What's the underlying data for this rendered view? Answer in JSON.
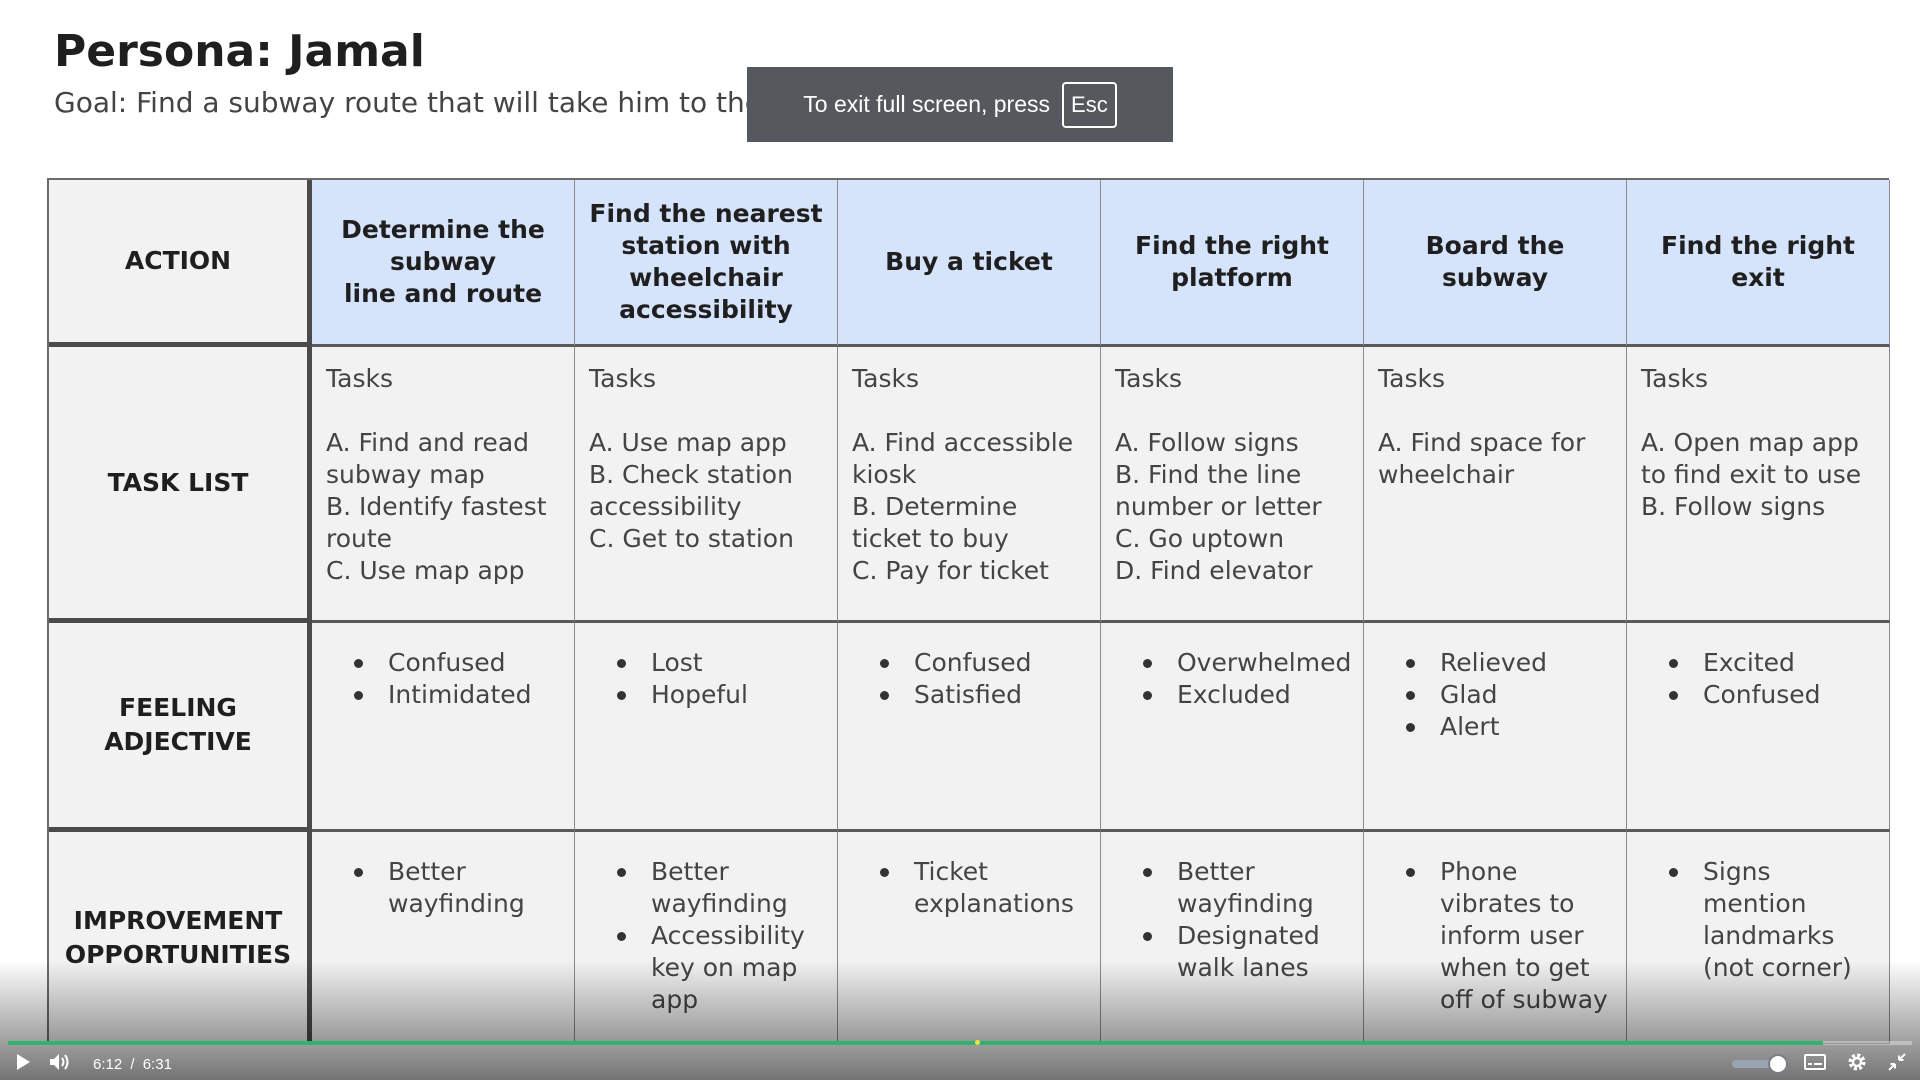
{
  "slide": {
    "title": "Persona: Jamal",
    "goal": "Goal: Find a subway route that will take him to the Empire State Building"
  },
  "fullscreen_toast": {
    "message": "To exit full screen, press",
    "key": "Esc"
  },
  "journey_map": {
    "row_headers": {
      "action": "ACTION",
      "task_list": "TASK LIST",
      "feeling": "FEELING ADJECTIVE",
      "improvement": "IMPROVEMENT OPPORTUNITIES"
    },
    "tasks_heading": "Tasks",
    "columns": [
      {
        "action": "Determine the subway\nline and route",
        "tasks": [
          "A. Find and read subway map",
          "B. Identify fastest route",
          "C. Use map app"
        ],
        "feelings": [
          "Confused",
          "Intimidated"
        ],
        "improvements": [
          "Better wayfinding"
        ]
      },
      {
        "action": "Find the nearest station with wheelchair accessibility",
        "tasks": [
          "A. Use map app",
          "B. Check station accessibility",
          "C. Get to station"
        ],
        "feelings": [
          "Lost",
          "Hopeful"
        ],
        "improvements": [
          "Better wayfinding",
          "Accessibility key on map app"
        ]
      },
      {
        "action": "Buy a ticket",
        "tasks": [
          "A. Find accessible kiosk",
          "B. Determine ticket to buy",
          "C. Pay for ticket"
        ],
        "feelings": [
          "Confused",
          "Satisfied"
        ],
        "improvements": [
          "Ticket explanations"
        ]
      },
      {
        "action": "Find the right platform",
        "tasks": [
          "A. Follow signs",
          "B. Find the line number or letter",
          "C. Go uptown",
          "D. Find elevator"
        ],
        "feelings": [
          "Overwhelmed",
          "Excluded"
        ],
        "improvements": [
          "Better wayfinding",
          "Designated walk lanes"
        ]
      },
      {
        "action": "Board the subway",
        "tasks": [
          "A. Find space for wheelchair"
        ],
        "feelings": [
          "Relieved",
          "Glad",
          "Alert"
        ],
        "improvements": [
          "Phone vibrates to inform user when to get off of subway"
        ]
      },
      {
        "action": "Find the right exit",
        "tasks": [
          "A. Open map app to find exit to use",
          "B. Follow signs"
        ],
        "feelings": [
          "Excited",
          "Confused"
        ],
        "improvements": [
          "Signs mention landmarks (not corner)"
        ]
      }
    ]
  },
  "player": {
    "current_time": "6:12",
    "separator": "/",
    "duration": "6:31",
    "progress_fraction": 0.953,
    "marker_fraction": 0.508,
    "volume_fraction": 1.0,
    "icons": {
      "play": "play-icon",
      "volume": "volume-icon",
      "captions": "captions-icon",
      "settings": "gear-icon",
      "exit_fullscreen": "exit-fullscreen-icon"
    },
    "colors": {
      "progress": "#2fb36e",
      "marker": "#f4e04a"
    }
  }
}
